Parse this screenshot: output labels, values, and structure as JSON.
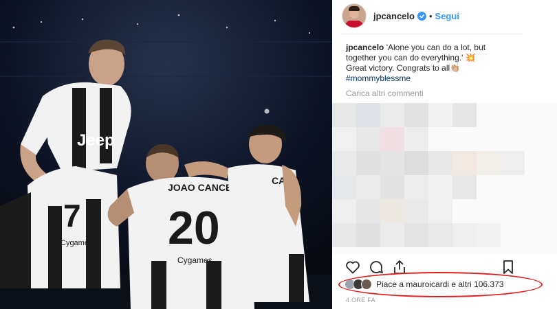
{
  "post": {
    "username": "jpcancelo",
    "follow_label": "Segui",
    "separator": "•",
    "caption_user": "jpcancelo",
    "caption_text": " 'Alone you can do a lot, but together you can do everything.' 💥 Great victory. Congrats to all👏🏼 ",
    "hashtag": "#mommyblessme",
    "load_more": "Carica altri commenti",
    "likes_text": "Piace a mauroicardi e altri 106.373",
    "timestamp": "4 ORE FA"
  },
  "photo": {
    "sponsor": "Jeep",
    "player_name": "JOAO CANCELO",
    "numbers": [
      "7",
      "20"
    ],
    "back_name": "CAN",
    "brand": "Cygames"
  },
  "icons": [
    "verified-badge-icon",
    "heart-icon",
    "comment-icon",
    "share-icon",
    "bookmark-icon"
  ],
  "colors": {
    "follow": "#3897f0",
    "hashtag": "#003569",
    "highlight": "#e02020"
  }
}
